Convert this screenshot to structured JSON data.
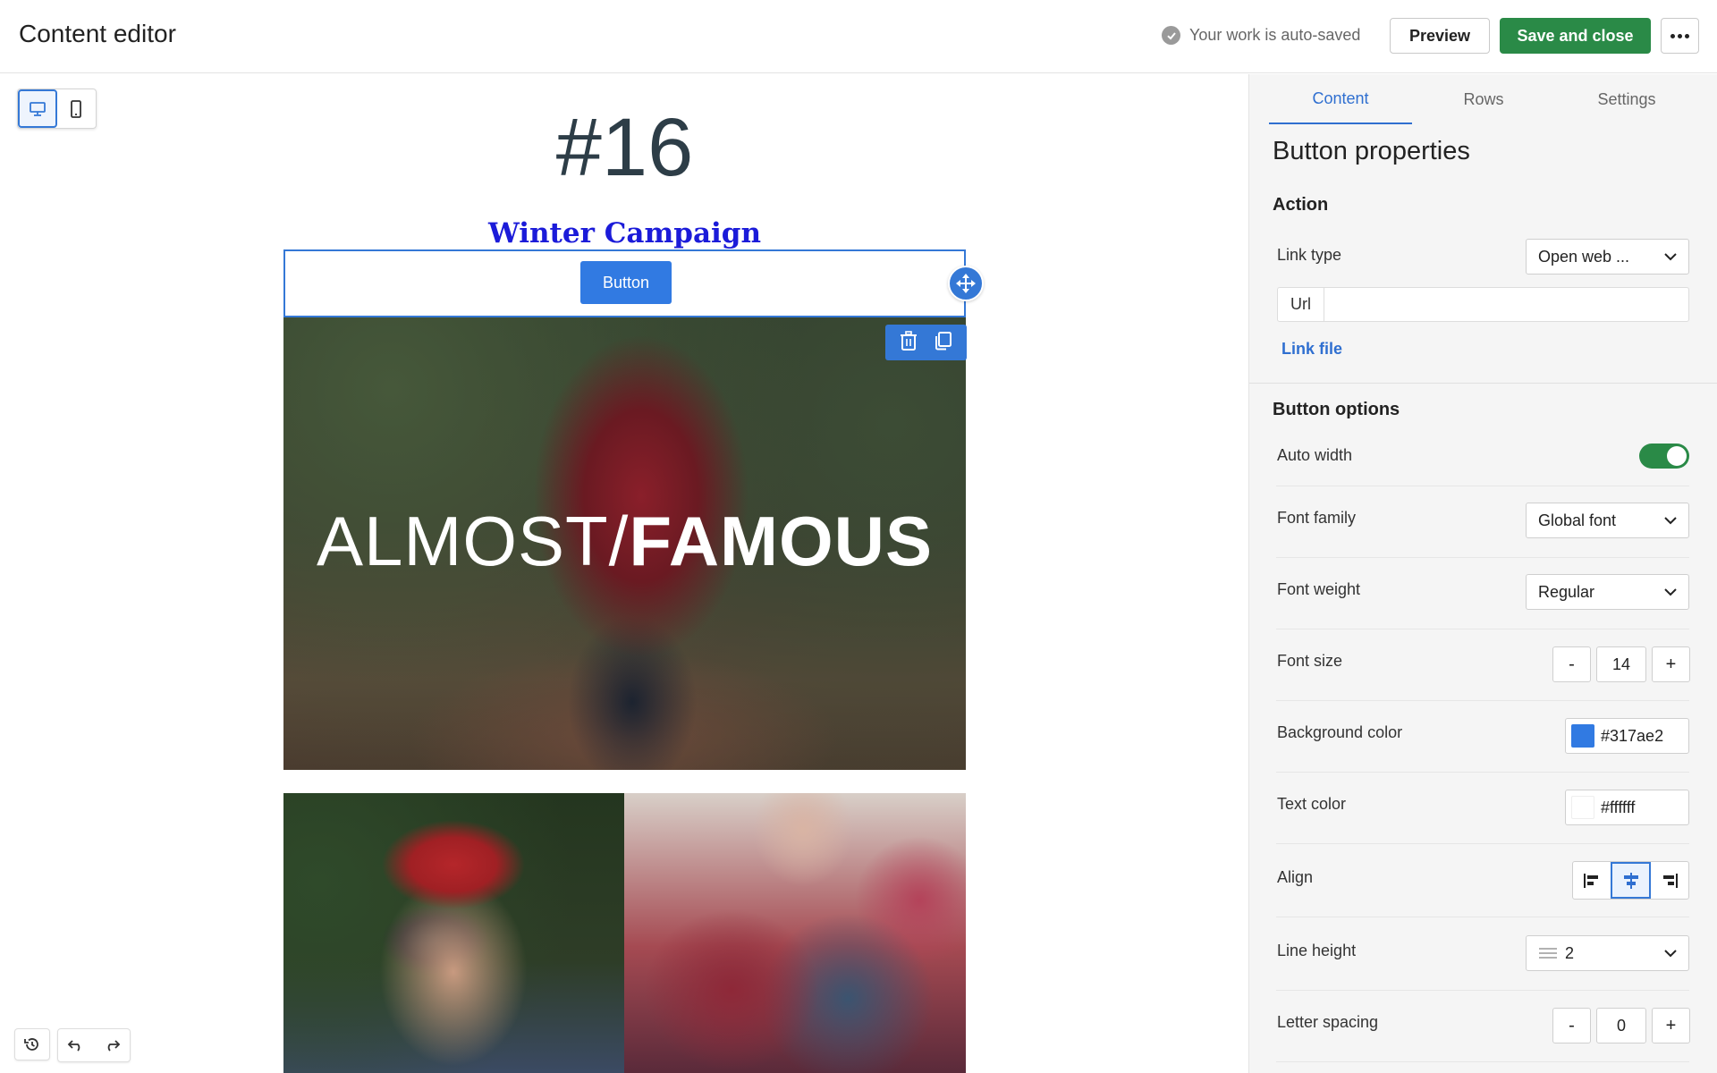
{
  "header": {
    "title": "Content editor",
    "autosave_text": "Your work is auto-saved",
    "preview_label": "Preview",
    "save_label": "Save and close"
  },
  "device_toggle": {
    "options": [
      "desktop",
      "mobile"
    ],
    "selected": "desktop"
  },
  "canvas": {
    "heading": "#16",
    "subheading": "Winter Campaign",
    "button_label": "Button",
    "hero_text_thin": "ALMOST/",
    "hero_text_bold": "FAMOUS"
  },
  "panel": {
    "tabs": [
      {
        "label": "Content",
        "active": true
      },
      {
        "label": "Rows",
        "active": false
      },
      {
        "label": "Settings",
        "active": false
      }
    ],
    "title": "Button properties",
    "action": {
      "title": "Action",
      "link_type_label": "Link type",
      "link_type_value": "Open web ...",
      "url_label": "Url",
      "url_value": "",
      "link_file_label": "Link file"
    },
    "options": {
      "title": "Button options",
      "auto_width_label": "Auto width",
      "auto_width_on": true,
      "font_family_label": "Font family",
      "font_family_value": "Global font",
      "font_weight_label": "Font weight",
      "font_weight_value": "Regular",
      "font_size_label": "Font size",
      "font_size_value": "14",
      "minus": "-",
      "plus": "+",
      "bg_color_label": "Background color",
      "bg_color_value": "#317ae2",
      "text_color_label": "Text color",
      "text_color_value": "#ffffff",
      "align_label": "Align",
      "align_value": "center",
      "line_height_label": "Line height",
      "line_height_value": "2",
      "letter_spacing_label": "Letter spacing",
      "letter_spacing_value": "0"
    }
  },
  "colors": {
    "accent": "#3478d6",
    "save_green": "#2a8a47",
    "button_bg": "#317ae2",
    "button_text": "#ffffff"
  }
}
